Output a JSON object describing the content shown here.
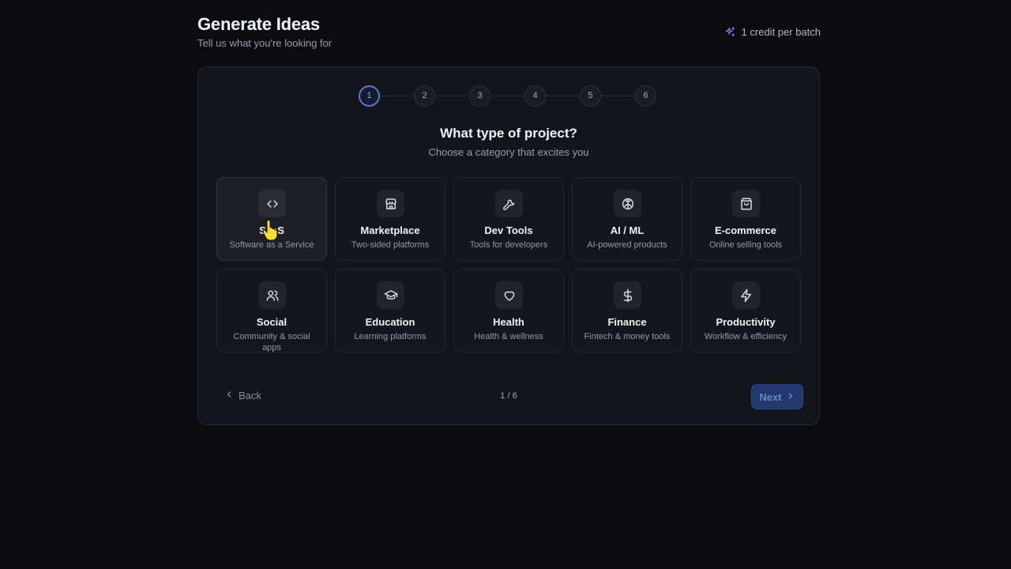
{
  "header": {
    "title": "Generate Ideas",
    "subtitle": "Tell us what you're looking for",
    "credit_text": "1 credit per batch",
    "credit_icon": "sparkles-icon"
  },
  "stepper": {
    "steps": [
      "1",
      "2",
      "3",
      "4",
      "5",
      "6"
    ],
    "active_step": 1
  },
  "question": {
    "title": "What type of project?",
    "subtitle": "Choose a category that excites you"
  },
  "categories": [
    {
      "name": "SaaS",
      "description": "Software as a Service",
      "icon": "code-icon"
    },
    {
      "name": "Marketplace",
      "description": "Two-sided platforms",
      "icon": "store-icon"
    },
    {
      "name": "Dev Tools",
      "description": "Tools for developers",
      "icon": "wrench-icon"
    },
    {
      "name": "AI / ML",
      "description": "AI-powered products",
      "icon": "brain-icon"
    },
    {
      "name": "E-commerce",
      "description": "Online selling tools",
      "icon": "shopping-bag-icon"
    },
    {
      "name": "Social",
      "description": "Community & social apps",
      "icon": "users-icon"
    },
    {
      "name": "Education",
      "description": "Learning platforms",
      "icon": "graduation-cap-icon"
    },
    {
      "name": "Health",
      "description": "Health & wellness",
      "icon": "heart-icon"
    },
    {
      "name": "Finance",
      "description": "Fintech & money tools",
      "icon": "dollar-icon"
    },
    {
      "name": "Productivity",
      "description": "Workflow & efficiency",
      "icon": "lightning-icon"
    }
  ],
  "footer": {
    "back_label": "Back",
    "page_counter": "1 / 6",
    "next_label": "Next"
  },
  "colors": {
    "background": "#0b0b10",
    "card": "#14151c",
    "accent": "#5a78d6",
    "next_button": "#22386e",
    "cursor": "#f5e02a"
  }
}
